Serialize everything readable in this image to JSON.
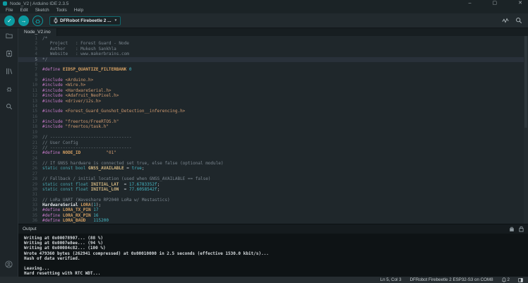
{
  "window": {
    "title": "Node_V2 | Arduino IDE 2.3.5"
  },
  "colors": {
    "accent_teal": "#0c9ba1",
    "editor_bg": "#1f272b",
    "output_bg": "#0e1315",
    "preprocessor": "#c67ac8",
    "macro": "#d7a163",
    "number": "#45b8c6",
    "comment": "#7a858e",
    "string": "#cf9a70"
  },
  "icons": {
    "app": "arduino-logo",
    "minimize": "–",
    "maximize": "▢",
    "close": "✕",
    "verify": "✓",
    "upload": "→",
    "debug": "bug",
    "caret": "▾",
    "sidebar": [
      "sketchbook",
      "boards-manager",
      "library-manager",
      "debug-panel",
      "search"
    ],
    "toolbar_right": [
      "serial-plotter",
      "serial-monitor"
    ],
    "output_header": [
      "clear-output",
      "toggle-autoscroll-lock"
    ],
    "statusbar": [
      "bell",
      "notifications-panel"
    ],
    "account": "account-circle"
  },
  "menu": {
    "items": [
      "File",
      "Edit",
      "Sketch",
      "Tools",
      "Help"
    ]
  },
  "toolbar": {
    "board_selector_label": "DFRobot Firebeetle 2 ..."
  },
  "tabs": [
    {
      "label": "Node_V2.ino",
      "active": true
    }
  ],
  "editor": {
    "current_line": 5,
    "lines": [
      {
        "n": 1,
        "t": [
          [
            "cmt",
            "/*"
          ]
        ]
      },
      {
        "n": 2,
        "t": [
          [
            "cmt",
            "   Project   : Forest Guard - Node"
          ]
        ]
      },
      {
        "n": 3,
        "t": [
          [
            "cmt",
            "   Author    : Mukesh Sankhla"
          ]
        ]
      },
      {
        "n": 4,
        "t": [
          [
            "cmt",
            "   Website   : www.makerbrains.com"
          ]
        ]
      },
      {
        "n": 5,
        "t": [
          [
            "cmt",
            "*/"
          ]
        ]
      },
      {
        "n": 6,
        "t": []
      },
      {
        "n": 7,
        "t": [
          [
            "pp",
            "#define"
          ],
          [
            "mac",
            " EIDSP_QUANTIZE_FILTERBANK"
          ],
          [
            "num",
            " 0"
          ]
        ]
      },
      {
        "n": 8,
        "t": []
      },
      {
        "n": 9,
        "t": [
          [
            "pp",
            "#include"
          ],
          [
            "hdr",
            " <Arduino.h>"
          ]
        ]
      },
      {
        "n": 10,
        "t": [
          [
            "pp",
            "#include"
          ],
          [
            "hdr",
            " <Wire.h>"
          ]
        ]
      },
      {
        "n": 11,
        "t": [
          [
            "pp",
            "#include"
          ],
          [
            "hdr",
            " <HardwareSerial.h>"
          ]
        ]
      },
      {
        "n": 12,
        "t": [
          [
            "pp",
            "#include"
          ],
          [
            "hdr",
            " <Adafruit_NeoPixel.h>"
          ]
        ]
      },
      {
        "n": 13,
        "t": [
          [
            "pp",
            "#include"
          ],
          [
            "hdr",
            " <driver/i2s.h>"
          ]
        ]
      },
      {
        "n": 14,
        "t": []
      },
      {
        "n": 15,
        "t": [
          [
            "pp",
            "#include"
          ],
          [
            "hdr",
            " <Forest_Guard_Gunshot_Detection__inferencing.h>"
          ]
        ]
      },
      {
        "n": 16,
        "t": []
      },
      {
        "n": 17,
        "t": [
          [
            "pp",
            "#include"
          ],
          [
            "str",
            " \"freertos/FreeRTOS.h\""
          ]
        ]
      },
      {
        "n": 18,
        "t": [
          [
            "pp",
            "#include"
          ],
          [
            "str",
            " \"freertos/task.h\""
          ]
        ]
      },
      {
        "n": 19,
        "t": []
      },
      {
        "n": 20,
        "t": [
          [
            "cmt",
            "// --------------------------------"
          ]
        ]
      },
      {
        "n": 21,
        "t": [
          [
            "cmt",
            "// User Config"
          ]
        ]
      },
      {
        "n": 22,
        "t": [
          [
            "cmt",
            "// --------------------------------"
          ]
        ]
      },
      {
        "n": 23,
        "t": [
          [
            "pp",
            "#define"
          ],
          [
            "mac",
            " NODE_ID"
          ],
          [
            "pl",
            "          "
          ],
          [
            "str",
            "\"01\""
          ]
        ]
      },
      {
        "n": 24,
        "t": []
      },
      {
        "n": 25,
        "t": [
          [
            "cmt",
            "// If GNSS hardware is connected set true, else false (optional module)"
          ]
        ]
      },
      {
        "n": 26,
        "t": [
          [
            "kw",
            "static const bool"
          ],
          [
            "cname",
            " GNSS_AVAILABLE"
          ],
          [
            "pl",
            " = "
          ],
          [
            "num",
            "true"
          ],
          [
            "pl",
            ";"
          ]
        ]
      },
      {
        "n": 27,
        "t": []
      },
      {
        "n": 28,
        "t": [
          [
            "cmt",
            "// Fallback / initial location (used when GNSS_AVAILABLE == false)"
          ]
        ]
      },
      {
        "n": 29,
        "t": [
          [
            "kw",
            "static const float"
          ],
          [
            "cname",
            " INITIAL_LAT"
          ],
          [
            "pl",
            "  = "
          ],
          [
            "num",
            "17.6783352f"
          ],
          [
            "pl",
            ";"
          ]
        ]
      },
      {
        "n": 30,
        "t": [
          [
            "kw",
            "static const float"
          ],
          [
            "cname",
            " INITIAL_LON"
          ],
          [
            "pl",
            "  = "
          ],
          [
            "num",
            "77.6058542f"
          ],
          [
            "pl",
            ";"
          ]
        ]
      },
      {
        "n": 31,
        "t": []
      },
      {
        "n": 32,
        "t": [
          [
            "cmt",
            "// LoRa UART (Waveshare RP2040 LoRa w/ Mestastics)"
          ]
        ]
      },
      {
        "n": 33,
        "t": [
          [
            "typ",
            "HardwareSerial"
          ],
          [
            "mac",
            " LORA"
          ],
          [
            "pl",
            "("
          ],
          [
            "num",
            "1"
          ],
          [
            "pl",
            ");"
          ]
        ]
      },
      {
        "n": 34,
        "t": [
          [
            "pp",
            "#define"
          ],
          [
            "mac",
            " LORA_TX_PIN"
          ],
          [
            "num",
            " 17"
          ]
        ]
      },
      {
        "n": 35,
        "t": [
          [
            "pp",
            "#define"
          ],
          [
            "mac",
            " LORA_RX_PIN"
          ],
          [
            "num",
            " 16"
          ]
        ]
      },
      {
        "n": 36,
        "t": [
          [
            "pp",
            "#define"
          ],
          [
            "mac",
            " LORA_BAUD"
          ],
          [
            "num",
            "   115200"
          ]
        ]
      }
    ]
  },
  "output": {
    "title": "Output",
    "lines": [
      "Writing at 0x00078907... (88 %)",
      "Writing at 0x0007e8ee... (94 %)",
      "Writing at 0x00084c82... (100 %)",
      "Wrote 479360 bytes (262941 compressed) at 0x00010000 in 2.5 seconds (effective 1530.0 kbit/s)...",
      "Hash of data verified.",
      "",
      "Leaving...",
      "Hard resetting with RTC WDT..."
    ]
  },
  "status": {
    "cursor_position": "Ln 5, Col 3",
    "board_port": "DFRobot Firebeetle 2 ESP32-S3 on COM8",
    "notification_count": "2"
  }
}
